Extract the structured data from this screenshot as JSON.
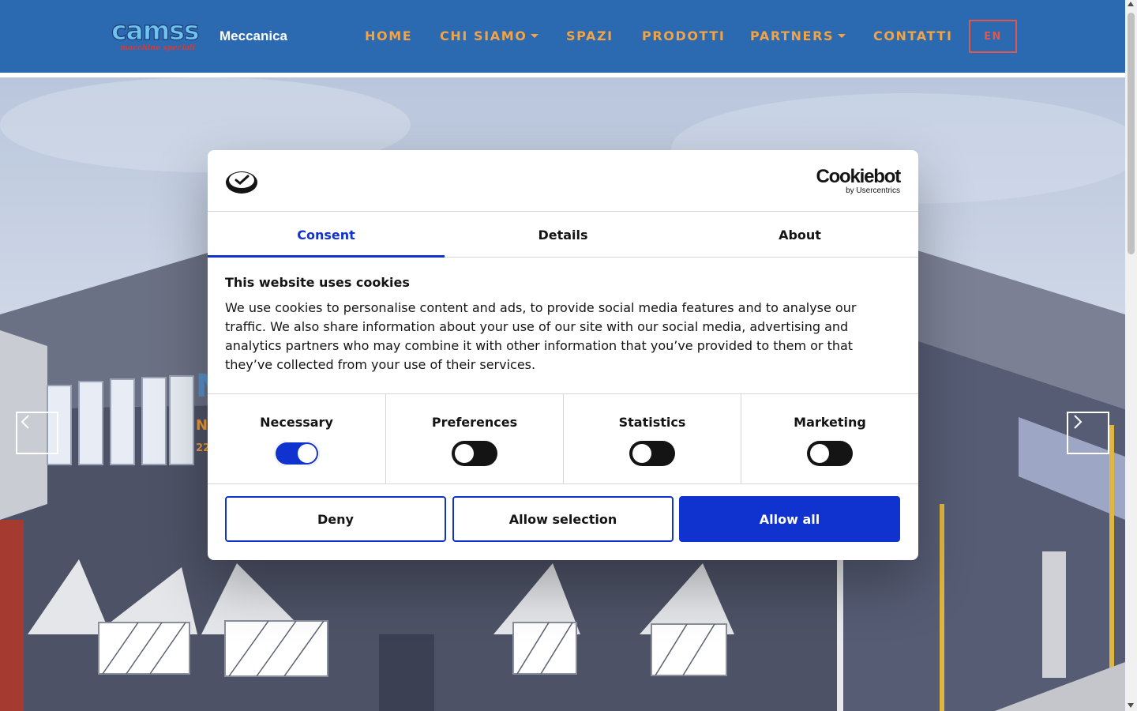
{
  "header": {
    "brand": "Meccanica",
    "logo_text": "camss",
    "logo_tagline": "macchine speciali",
    "nav": [
      {
        "label": "HOME",
        "dropdown": false
      },
      {
        "label": "CHI SIAMO",
        "dropdown": true
      },
      {
        "label": "SPAZI",
        "dropdown": false
      },
      {
        "label": "PRODOTTI",
        "dropdown": false
      },
      {
        "label": "PARTNERS",
        "dropdown": true
      },
      {
        "label": "CONTATTI",
        "dropdown": false
      }
    ],
    "lang_button": "EN"
  },
  "hero": {
    "title_fragment": "M",
    "subtitle_fragment": "N",
    "subtitle2_fragment": "22"
  },
  "cookie_dialog": {
    "brand": "Cookiebot",
    "brand_sub": "by Usercentrics",
    "tabs": [
      {
        "label": "Consent",
        "active": true
      },
      {
        "label": "Details",
        "active": false
      },
      {
        "label": "About",
        "active": false
      }
    ],
    "title": "This website uses cookies",
    "text": "We use cookies to personalise content and ads, to provide social media features and to analyse our traffic. We also share information about your use of our site with our social media, advertising and analytics partners who may combine it with other information that you’ve provided to them or that they’ve collected from your use of their services.",
    "toggles": [
      {
        "label": "Necessary",
        "on": true
      },
      {
        "label": "Preferences",
        "on": false
      },
      {
        "label": "Statistics",
        "on": false
      },
      {
        "label": "Marketing",
        "on": false
      }
    ],
    "buttons": {
      "deny": "Deny",
      "allow_selection": "Allow selection",
      "allow_all": "Allow all"
    }
  },
  "colors": {
    "header_bg": "#2b69b1",
    "nav_text": "#f0a445",
    "lang_border": "#e2574c",
    "accent": "#1032cf"
  }
}
